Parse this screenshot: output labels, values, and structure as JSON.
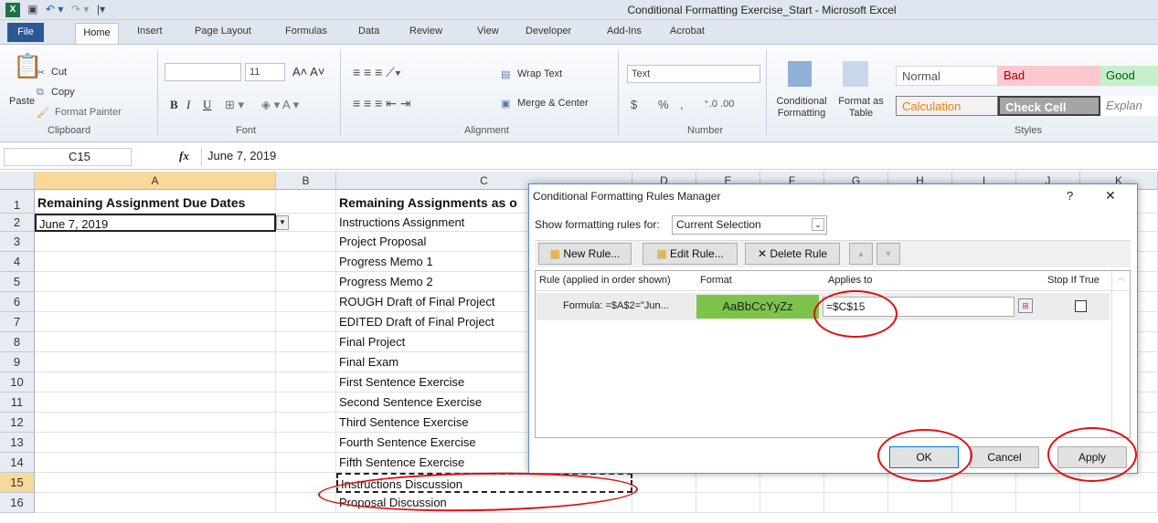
{
  "window": {
    "title": "Conditional Formatting Exercise_Start - Microsoft Excel",
    "app_icon": "excel-icon"
  },
  "ribbon_tabs": [
    "File",
    "Home",
    "Insert",
    "Page Layout",
    "Formulas",
    "Data",
    "Review",
    "View",
    "Developer",
    "Add-Ins",
    "Acrobat"
  ],
  "ribbon": {
    "clipboard": {
      "paste": "Paste",
      "cut": "Cut",
      "copy": "Copy",
      "format_painter": "Format Painter",
      "group": "Clipboard"
    },
    "font": {
      "size": "11",
      "group": "Font",
      "bold": "B",
      "italic": "I",
      "underline": "U"
    },
    "alignment": {
      "wrap_text": "Wrap Text",
      "merge_center": "Merge & Center",
      "group": "Alignment"
    },
    "number": {
      "format": "Text",
      "currency": "$",
      "percent": "%",
      "comma": ",",
      "group": "Number"
    },
    "styles": {
      "conditional_formatting": "Conditional Formatting",
      "format_as_table": "Format as Table",
      "normal": "Normal",
      "bad": "Bad",
      "good": "Good",
      "calculation": "Calculation",
      "check_cell": "Check Cell",
      "explanatory": "Explan",
      "group": "Styles",
      "color_bad_bg": "#ffc7ce",
      "color_good_bg": "#c6efce",
      "color_check_bg": "#a5a5a5"
    }
  },
  "formula_bar": {
    "name_box": "C15",
    "fx": "fx",
    "value": "June 7, 2019"
  },
  "grid": {
    "columns": [
      "A",
      "B",
      "C",
      "D",
      "E",
      "F",
      "G",
      "H",
      "I",
      "J",
      "K"
    ],
    "rows": [
      "1",
      "2",
      "3",
      "4",
      "5",
      "6",
      "7",
      "8",
      "9",
      "10",
      "11",
      "12",
      "13",
      "14",
      "15",
      "16"
    ],
    "a1": "Remaining Assignment Due Dates",
    "a2": "June 7, 2019",
    "c1": "Remaining Assignments as o",
    "c_values": [
      "Instructions Assignment",
      "Project Proposal",
      "Progress Memo 1",
      "Progress Memo 2",
      "ROUGH Draft of Final Project",
      "EDITED Draft of Final Project",
      "Final Project",
      "Final Exam",
      "First Sentence Exercise",
      "Second Sentence Exercise",
      "Third Sentence Exercise",
      "Fourth Sentence Exercise",
      "Fifth Sentence Exercise",
      "Instructions Discussion",
      "Proposal Discussion"
    ]
  },
  "dialog": {
    "title": "Conditional Formatting Rules Manager",
    "help": "?",
    "close": "✕",
    "show_rules_label": "Show formatting rules for:",
    "show_rules_value": "Current Selection",
    "new_rule": "New Rule...",
    "edit_rule": "Edit Rule...",
    "delete_rule": "Delete Rule",
    "col_rule": "Rule (applied in order shown)",
    "col_format": "Format",
    "col_applies": "Applies to",
    "col_stop": "Stop If True",
    "rule_formula": "Formula: =$A$2=\"Jun...",
    "rule_preview": "AaBbCcYyZz",
    "rule_applies": "=$C$15",
    "ok": "OK",
    "cancel": "Cancel",
    "apply": "Apply",
    "preview_color": "#7dc34a"
  }
}
